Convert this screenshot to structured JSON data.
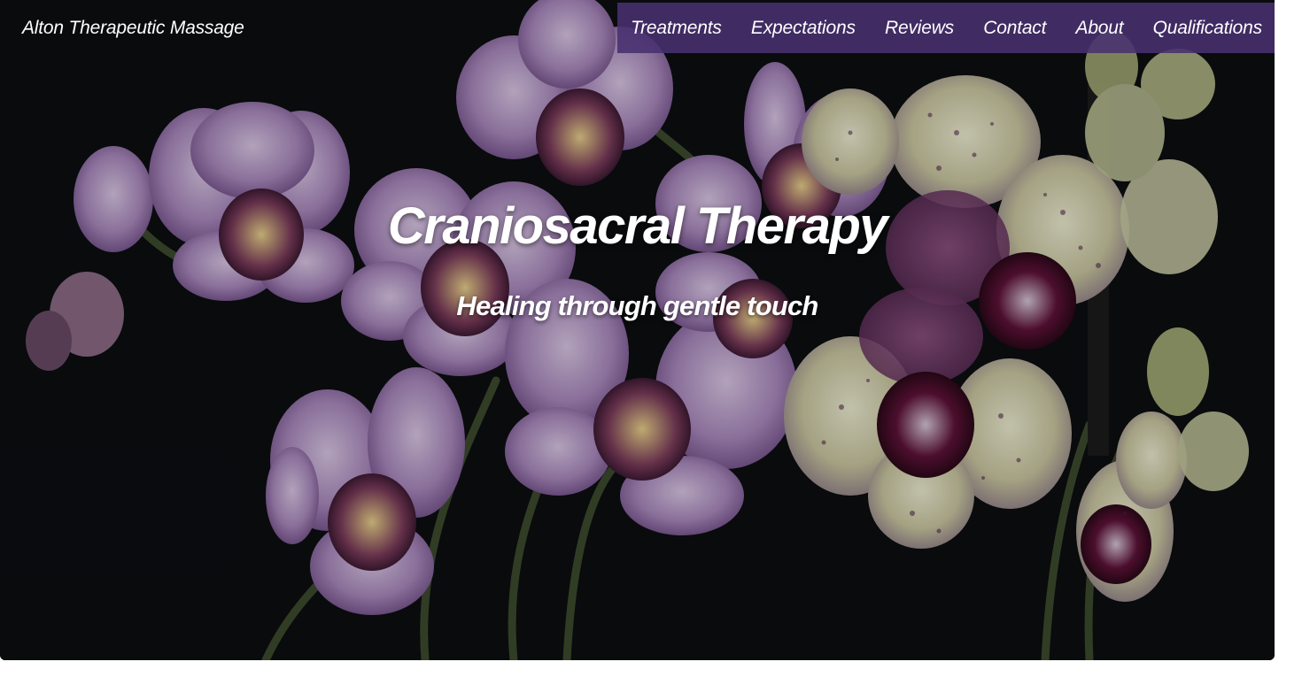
{
  "site": {
    "name": "Alton Therapeutic Massage"
  },
  "nav": {
    "items": [
      {
        "label": "Treatments"
      },
      {
        "label": "Expectations"
      },
      {
        "label": "Reviews"
      },
      {
        "label": "Contact"
      },
      {
        "label": "About"
      },
      {
        "label": "Qualifications"
      }
    ]
  },
  "hero": {
    "title": "Craniosacral Therapy",
    "subtitle": "Healing through gentle touch",
    "background_image": "orchid-flowers-photo"
  },
  "colors": {
    "nav_background": "#483070",
    "hero_background": "#0a0d10",
    "text": "#ffffff"
  }
}
